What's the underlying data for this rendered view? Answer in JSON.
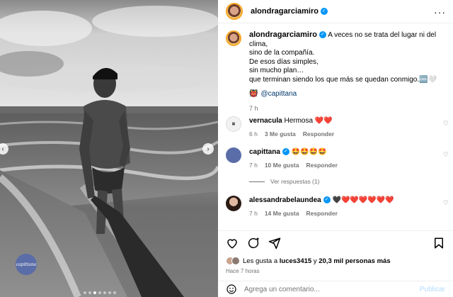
{
  "post": {
    "author": "alondragarciamiro",
    "caption_lines": [
      "A veces no se trata del lugar ni del clima,",
      "sino de la compañía.",
      "De esos días simples,",
      "sin mucho plan…",
      "que terminan siendo los que más se quedan conmigo.🆒🤍"
    ],
    "mention_emoji": "👹",
    "mention": "@capittana",
    "time": "7 h",
    "watermark": "capittana"
  },
  "comments": [
    {
      "user": "vernacula",
      "text": "Hermosa ❤️❤️",
      "time": "6 h",
      "likes": "3 Me gusta",
      "reply": "Responder",
      "avatar_color": "#f2f2f2"
    },
    {
      "user": "capittana",
      "verified": true,
      "text": "🤩🤩🤩🤩",
      "time": "7 h",
      "likes": "10 Me gusta",
      "reply": "Responder",
      "avatar_color": "#5a6da8",
      "view_replies": "Ver respuestas (1)"
    },
    {
      "user": "alessandrabelaundea",
      "verified": true,
      "text": "🖤❤️❤️❤️❤️❤️❤️",
      "time": "7 h",
      "likes": "14 Me gusta",
      "reply": "Responder",
      "avatar_color": "#c9a38d"
    }
  ],
  "likes": {
    "prefix": "Les gusta a",
    "user": "luces3415",
    "connector": "y",
    "count": "20,3 mil personas más"
  },
  "date": "Hace 7 horas",
  "composer": {
    "placeholder": "Agrega un comentario...",
    "publish": "Publicar"
  },
  "icons": [
    "heart-icon",
    "comment-icon",
    "share-icon",
    "bookmark-icon",
    "emoji-icon",
    "more-icon",
    "verified-icon",
    "chevron-left-icon",
    "chevron-right-icon"
  ]
}
